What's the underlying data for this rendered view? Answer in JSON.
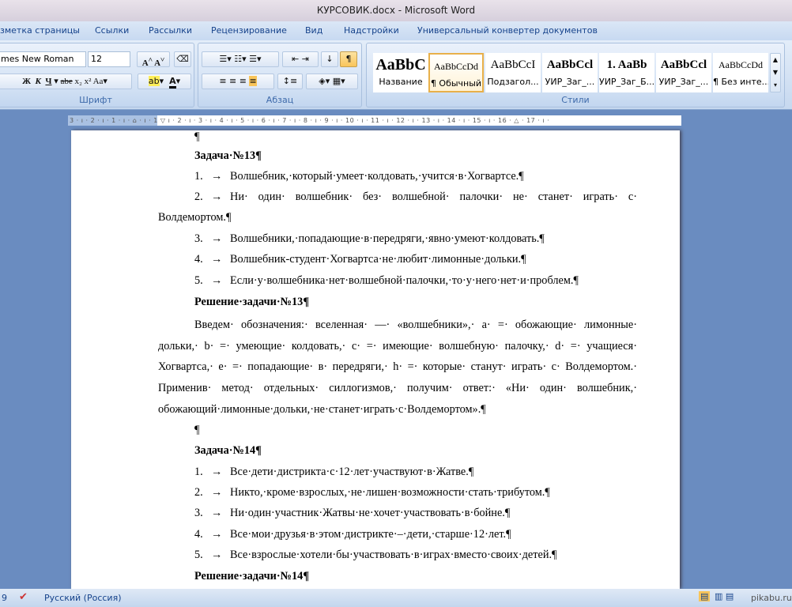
{
  "window": {
    "title": "КУРСОВИК.docx - Microsoft Word"
  },
  "tabs": [
    "зметка страницы",
    "Ссылки",
    "Рассылки",
    "Рецензирование",
    "Вид",
    "Надстройки",
    "Универсальный конвертер документов"
  ],
  "font_group": {
    "font_name": "mes New Roman",
    "font_size": "12",
    "label": "Шрифт",
    "buttons": [
      "A˄",
      "A˅",
      "Ж",
      "К",
      "Ч",
      "abe",
      "x₂",
      "x²",
      "Aa",
      "ab",
      "A"
    ]
  },
  "paragraph_group": {
    "label": "Абзац",
    "pilcrow": "¶"
  },
  "styles_group": {
    "label": "Стили",
    "items": [
      {
        "preview": "AaBbC",
        "name": "Название"
      },
      {
        "preview": "AaBbCcDd",
        "name": "¶ Обычный",
        "selected": true
      },
      {
        "preview": "AaBbCcI",
        "name": "Подзагол..."
      },
      {
        "preview": "AaBbCcl",
        "name": "УИР_Заг_..."
      },
      {
        "preview": "1. AaBb",
        "name": "УИР_Заг_Б..."
      },
      {
        "preview": "AaBbCcl",
        "name": "УИР_Заг_..."
      },
      {
        "preview": "AaBbCcDd",
        "name": "¶ Без инте..."
      }
    ]
  },
  "ruler": {
    "text": "3 · ı · 2 · ı · 1 · ı · ⌂ · ı · 1 ▽ ı · 2 · ı · 3 · ı · 4 · ı · 5 · ı · 6 · ı · 7 · ı · 8 · ı · 9 · ı · 10 · ı · 11 · ı · 12 · ı · 13 · ı · 14 · ı · 15 · ı · 16 · △ · 17 · ı ·"
  },
  "document": {
    "lines": [
      {
        "t": "¶",
        "cls": "ind"
      },
      {
        "t": "Задача·№13¶",
        "cls": "ind b"
      },
      {
        "n": "1.",
        "t": "Волшебник,·который·умеет·колдовать,·учится·в·Хогвартсе.¶",
        "cls": "ind"
      },
      {
        "n": "2.",
        "t": "Ни· один· волшебник· без· волшебной· палочки· не· станет· играть· с·",
        "cls": "ind j"
      },
      {
        "t": "Волдемортом.¶",
        "cls": ""
      },
      {
        "n": "3.",
        "t": "Волшебники,·попадающие·в·передряги,·явно·умеют·колдовать.¶",
        "cls": "ind"
      },
      {
        "n": "4.",
        "t": "Волшебник-студент·Хогвартса·не·любит·лимонные·дольки.¶",
        "cls": "ind"
      },
      {
        "n": "5.",
        "t": "Если·у·волшебника·нет·волшебной·палочки,·то·у·него·нет·и·проблем.¶",
        "cls": "ind"
      },
      {
        "t": "Решение·задачи·№13¶",
        "cls": "ind b"
      },
      {
        "t": "Введем· обозначения:· вселенная· —· «волшебники»,· a· =· обожающие· лимонные·",
        "cls": "ind j"
      },
      {
        "t": "дольки,· b· =· умеющие· колдовать,· c· =· имеющие· волшебную· палочку,· d· =· учащиеся·",
        "cls": "j"
      },
      {
        "t": "Хогвартса,· e· =· попадающие· в· передряги,· h· =· которые· станут· играть· с· Волдемортом.·",
        "cls": "j"
      },
      {
        "t": "Применив· метод· отдельных· силлогизмов,· получим· ответ:· «Ни· один· волшебник,·",
        "cls": "j"
      },
      {
        "t": "обожающий·лимонные·дольки,·не·станет·играть·с·Волдемортом».¶",
        "cls": ""
      },
      {
        "t": "¶",
        "cls": "ind"
      },
      {
        "t": "Задача·№14¶",
        "cls": "ind b"
      },
      {
        "n": "1.",
        "t": "Все·дети·дистрикта·с·12·лет·участвуют·в·Жатве.¶",
        "cls": "ind"
      },
      {
        "n": "2.",
        "t": "Никто,·кроме·взрослых,·не·лишен·возможности·стать·трибутом.¶",
        "cls": "ind"
      },
      {
        "n": "3.",
        "t": "Ни·один·участник·Жатвы·не·хочет·участвовать·в·бойне.¶",
        "cls": "ind"
      },
      {
        "n": "4.",
        "t": "Все·мои·друзья·в·этом·дистрикте·–·дети,·старше·12·лет.¶",
        "cls": "ind"
      },
      {
        "n": "5.",
        "t": "Все·взрослые·хотели·бы·участвовать·в·играх·вместо·своих·детей.¶",
        "cls": "ind"
      },
      {
        "t": "Решение·задачи·№14¶",
        "cls": "ind b"
      }
    ]
  },
  "statusbar": {
    "page_fragment": "9",
    "language": "Русский (Россия)",
    "watermark": "pikabu.ru"
  },
  "colors": {
    "accent": "#f9c55a",
    "ribbon": "#c6d8ef",
    "workspace": "#6a8cc0"
  }
}
